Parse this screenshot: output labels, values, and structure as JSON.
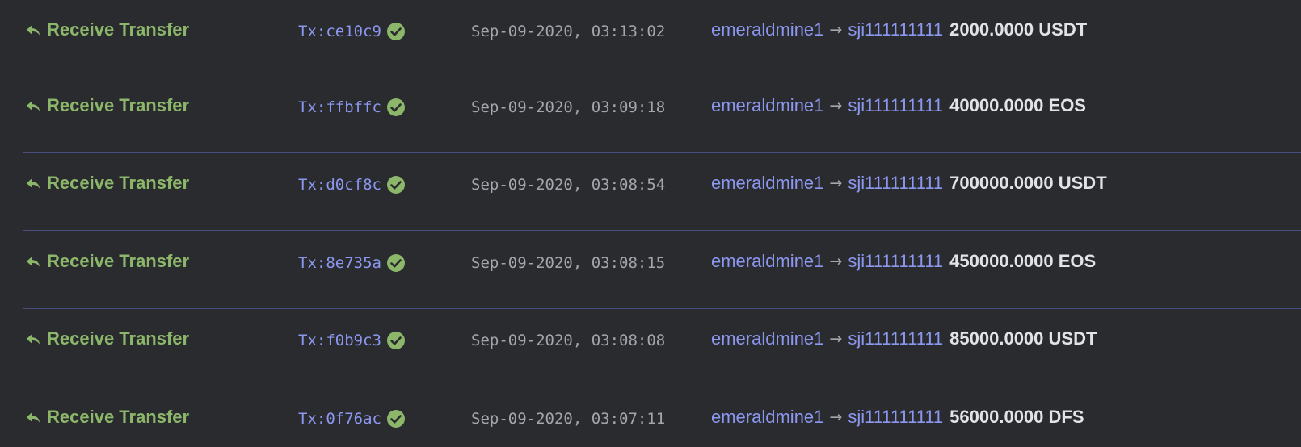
{
  "colors": {
    "background": "#2a2b2e",
    "action_green": "#8cb66a",
    "link_blue": "#8c97f0",
    "muted_gray": "#a3a6ad",
    "amount_white": "#e2e3e6",
    "divider": "#4a4f80",
    "check_green": "#8cb66a"
  },
  "icons": {
    "action": "reply-arrow-icon",
    "status": "check-circle-icon",
    "direction": "right-arrow-icon"
  },
  "transactions": [
    {
      "action": "Receive Transfer",
      "txid": "Tx:ce10c9",
      "time": "Sep-09-2020, 03:13:02",
      "from": "emeraldmine1",
      "arrow": "→",
      "to": "sji111111111",
      "amount": "2000.0000 USDT"
    },
    {
      "action": "Receive Transfer",
      "txid": "Tx:ffbffc",
      "time": "Sep-09-2020, 03:09:18",
      "from": "emeraldmine1",
      "arrow": "→",
      "to": "sji111111111",
      "amount": "40000.0000 EOS"
    },
    {
      "action": "Receive Transfer",
      "txid": "Tx:d0cf8c",
      "time": "Sep-09-2020, 03:08:54",
      "from": "emeraldmine1",
      "arrow": "→",
      "to": "sji111111111",
      "amount": "700000.0000 USDT"
    },
    {
      "action": "Receive Transfer",
      "txid": "Tx:8e735a",
      "time": "Sep-09-2020, 03:08:15",
      "from": "emeraldmine1",
      "arrow": "→",
      "to": "sji111111111",
      "amount": "450000.0000 EOS"
    },
    {
      "action": "Receive Transfer",
      "txid": "Tx:f0b9c3",
      "time": "Sep-09-2020, 03:08:08",
      "from": "emeraldmine1",
      "arrow": "→",
      "to": "sji111111111",
      "amount": "85000.0000 USDT"
    },
    {
      "action": "Receive Transfer",
      "txid": "Tx:0f76ac",
      "time": "Sep-09-2020, 03:07:11",
      "from": "emeraldmine1",
      "arrow": "→",
      "to": "sji111111111",
      "amount": "56000.0000 DFS"
    }
  ]
}
